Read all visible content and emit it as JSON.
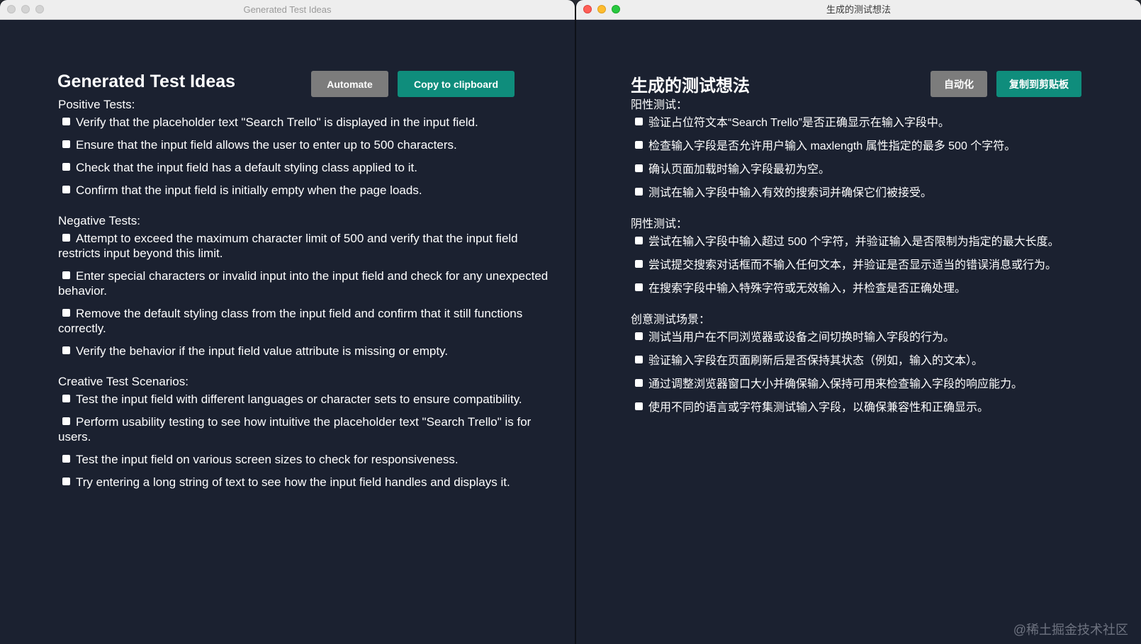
{
  "left_window": {
    "title": "Generated Test Ideas",
    "heading": "Generated Test Ideas",
    "buttons": {
      "automate": "Automate",
      "copy": "Copy to clipboard"
    },
    "sections": [
      {
        "title": "Positive Tests:",
        "items": [
          "Verify that the placeholder text \"Search Trello\" is displayed in the input field.",
          "Ensure that the input field allows the user to enter up to 500 characters.",
          "Check that the input field has a default styling class applied to it.",
          "Confirm that the input field is initially empty when the page loads."
        ]
      },
      {
        "title": "Negative Tests:",
        "items": [
          "Attempt to exceed the maximum character limit of 500 and verify that the input field restricts input beyond this limit.",
          "Enter special characters or invalid input into the input field and check for any unexpected behavior.",
          "Remove the default styling class from the input field and confirm that it still functions correctly.",
          "Verify the behavior if the input field value attribute is missing or empty."
        ]
      },
      {
        "title": "Creative Test Scenarios:",
        "items": [
          "Test the input field with different languages or character sets to ensure compatibility.",
          "Perform usability testing to see how intuitive the placeholder text \"Search Trello\" is for users.",
          "Test the input field on various screen sizes to check for responsiveness.",
          "Try entering a long string of text to see how the input field handles and displays it."
        ]
      }
    ]
  },
  "right_window": {
    "title": "生成的测试想法",
    "heading": "生成的测试想法",
    "buttons": {
      "automate": "自动化",
      "copy": "复制到剪贴板"
    },
    "sections": [
      {
        "title": "阳性测试：",
        "items": [
          "验证占位符文本“Search Trello”是否正确显示在输入字段中。",
          "检查输入字段是否允许用户输入 maxlength 属性指定的最多 500 个字符。",
          "确认页面加载时输入字段最初为空。",
          "测试在输入字段中输入有效的搜索词并确保它们被接受。"
        ]
      },
      {
        "title": "阴性测试：",
        "items": [
          "尝试在输入字段中输入超过 500 个字符，并验证输入是否限制为指定的最大长度。",
          "尝试提交搜索对话框而不输入任何文本，并验证是否显示适当的错误消息或行为。",
          "在搜索字段中输入特殊字符或无效输入，并检查是否正确处理。"
        ]
      },
      {
        "title": "创意测试场景：",
        "items": [
          "测试当用户在不同浏览器或设备之间切换时输入字段的行为。",
          "验证输入字段在页面刷新后是否保持其状态（例如，输入的文本）。",
          "通过调整浏览器窗口大小并确保输入保持可用来检查输入字段的响应能力。",
          "使用不同的语言或字符集测试输入字段，以确保兼容性和正确显示。"
        ]
      }
    ]
  },
  "watermark": "@稀土掘金技术社区",
  "colors": {
    "background": "#1b2130",
    "teal_button": "#0f8d7c",
    "gray_button": "#7c7c7c"
  }
}
